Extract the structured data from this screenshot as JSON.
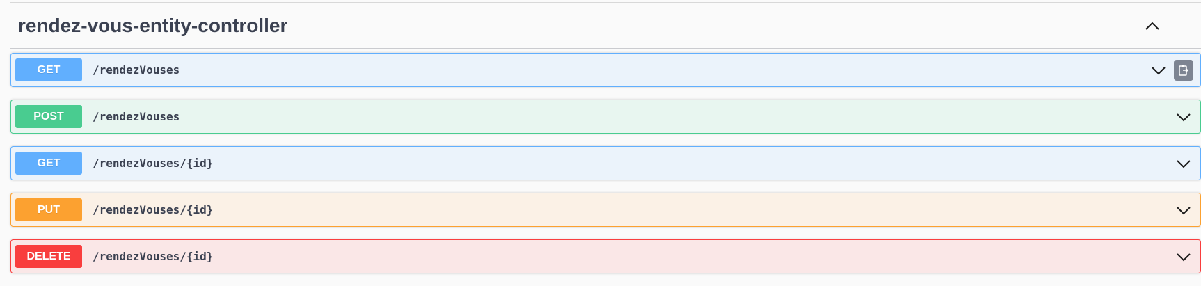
{
  "controller": {
    "title": "rendez-vous-entity-controller"
  },
  "operations": [
    {
      "method": "GET",
      "path": "/rendezVouses",
      "color": "#61affe",
      "bg": "#ebf3fb",
      "border": "#61affe",
      "has_copy": true
    },
    {
      "method": "POST",
      "path": "/rendezVouses",
      "color": "#49cc90",
      "bg": "#e8f6f0",
      "border": "#49cc90",
      "has_copy": false
    },
    {
      "method": "GET",
      "path": "/rendezVouses/{id}",
      "color": "#61affe",
      "bg": "#ebf3fb",
      "border": "#61affe",
      "has_copy": false
    },
    {
      "method": "PUT",
      "path": "/rendezVouses/{id}",
      "color": "#fca130",
      "bg": "#fbf1e6",
      "border": "#fca130",
      "has_copy": false
    },
    {
      "method": "DELETE",
      "path": "/rendezVouses/{id}",
      "color": "#f93e3e",
      "bg": "#fae7e7",
      "border": "#f93e3e",
      "has_copy": false
    }
  ],
  "icons": {
    "collapse": "chevron-up-icon",
    "expand": "chevron-down-icon",
    "copy": "copy-to-clipboard-icon"
  }
}
